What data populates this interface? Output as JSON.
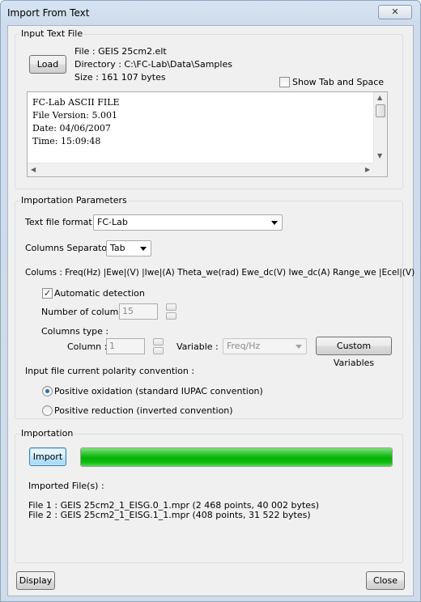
{
  "window": {
    "title": "Import From Text",
    "close_glyph": "✕"
  },
  "input_text_file": {
    "group_label": "Input Text File",
    "load_label": "Load",
    "file_line": "File : GEIS 25cm2.elt",
    "directory_line": "Directory : C:\\FC-Lab\\Data\\Samples",
    "size_line": "Size : 161 107 bytes",
    "show_tab_label": "Show Tab and Space",
    "show_tab_checked": false,
    "preview_lines": [
      "FC-Lab ASCII FILE",
      "File Version: 5.001",
      "Date: 04/06/2007",
      "Time: 15:09:48"
    ]
  },
  "importation_parameters": {
    "group_label": "Importation Parameters",
    "format_label": "Text file format :",
    "format_value": "FC-Lab",
    "separator_label": "Columns Separator :",
    "separator_value": "Tab",
    "columns_line": "Colums : Freq(Hz) |Ewe|(V) |Iwe|(A) Theta_we(rad) Ewe_dc(V) Iwe_dc(A) Range_we |Ecel|(V)",
    "auto_detect_label": "Automatic detection",
    "auto_detect_checked": true,
    "num_columns_label": "Number of columns",
    "num_columns_value": "15",
    "columns_type_label": "Columns type :",
    "column_label": "Column :",
    "column_value": "1",
    "variable_label": "Variable :",
    "variable_value": "Freq/Hz",
    "custom_variables_label": "Custom Variables",
    "polarity_label": "Input file current polarity convention :",
    "polarity_options": [
      {
        "label": "Positive oxidation (standard IUPAC convention)",
        "selected": true
      },
      {
        "label": "Positive reduction (inverted convention)",
        "selected": false
      }
    ]
  },
  "importation": {
    "group_label": "Importation",
    "import_label": "Import",
    "progress": 1.0,
    "progress_color": "#0fbd0f",
    "imported_files_label": "Imported File(s) :",
    "files": [
      "File 1 : GEIS 25cm2_1_EISG.0_1.mpr   (2 468 points, 40 002 bytes)",
      "File 2 : GEIS 25cm2_1_EISG.1_1.mpr   (408 points, 31 522 bytes)"
    ]
  },
  "footer": {
    "display_label": "Display",
    "close_label": "Close"
  }
}
